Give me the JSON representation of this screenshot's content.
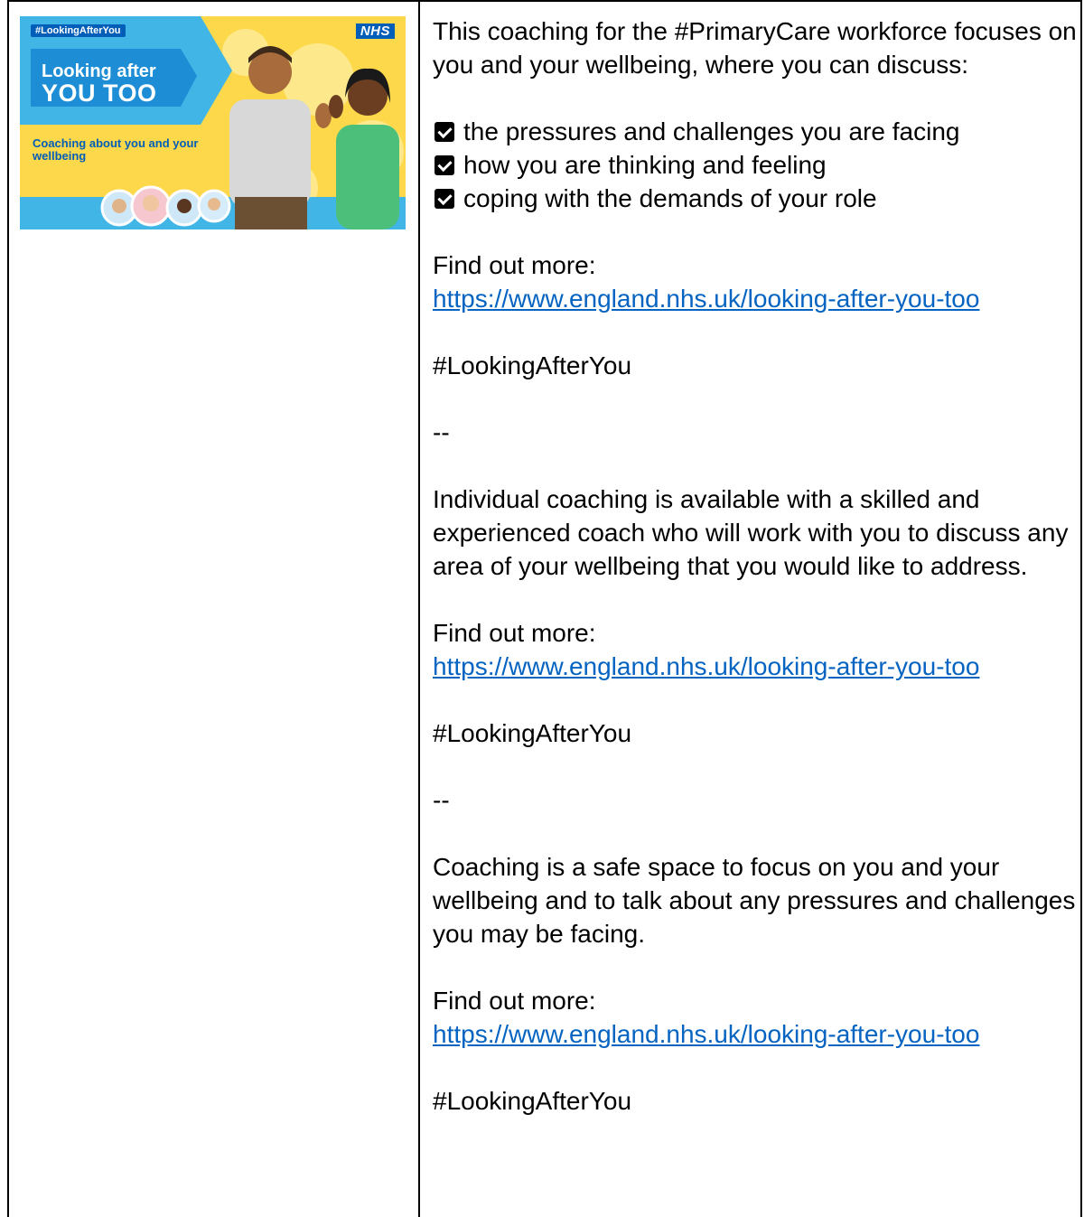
{
  "banner": {
    "hashtag": "#LookingAfterYou",
    "logo_text": "NHS",
    "title_line1": "Looking after",
    "title_line2": "YOU TOO",
    "subtitle": "Coaching about you and your wellbeing"
  },
  "section1": {
    "intro": "This coaching for the #PrimaryCare workforce focuses on you and your wellbeing, where you can discuss:",
    "checklist": [
      "the pressures and challenges you are facing",
      "how you are thinking and feeling",
      "coping with the demands of your role"
    ],
    "find_out_more": "Find out more:",
    "link": "https://www.england.nhs.uk/looking-after-you-too",
    "hashtag": "#LookingAfterYou"
  },
  "separator1": "--",
  "section2": {
    "body": "Individual coaching is available with a skilled and experienced coach who will work with you to discuss any area of your wellbeing that you would like to address.",
    "find_out_more": "Find out more:",
    "link": "https://www.england.nhs.uk/looking-after-you-too",
    "hashtag": "#LookingAfterYou"
  },
  "separator2": "--",
  "section3": {
    "body": "Coaching is a safe space to focus on you and your wellbeing and to talk about any pressures and challenges you may be facing.",
    "find_out_more": "Find out more:",
    "link": "https://www.england.nhs.uk/looking-after-you-too",
    "hashtag": "#LookingAfterYou"
  },
  "colors": {
    "nhs_blue": "#005eb8",
    "banner_yellow": "#fcd84a",
    "link_blue": "#0563c1"
  }
}
